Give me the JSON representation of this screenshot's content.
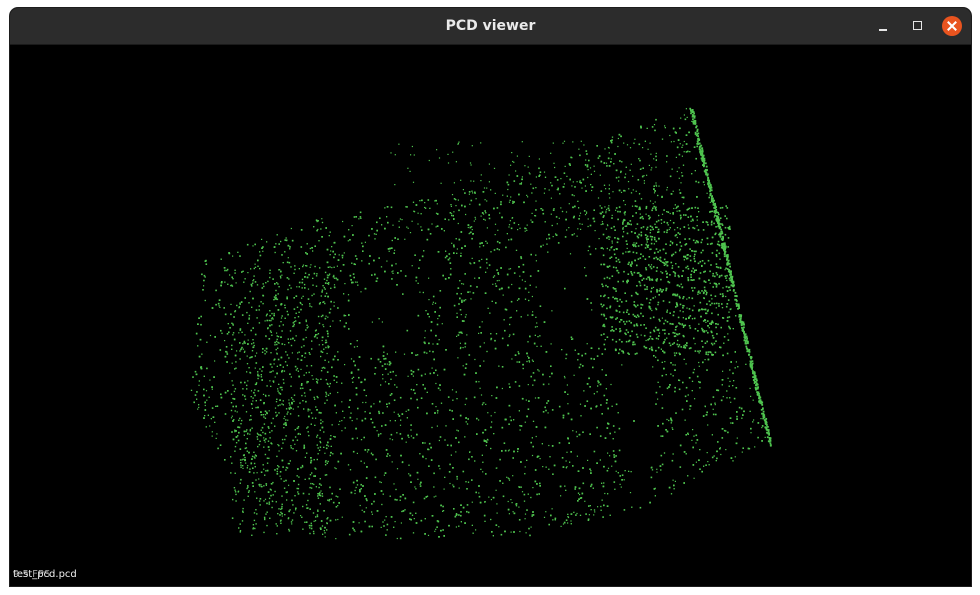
{
  "window": {
    "title": "PCD viewer"
  },
  "viewer": {
    "cloud_id": "test_pcd.pcd",
    "fps_text": "9.5 FPS",
    "point_color": "#4fc44f",
    "background": "#000000"
  }
}
